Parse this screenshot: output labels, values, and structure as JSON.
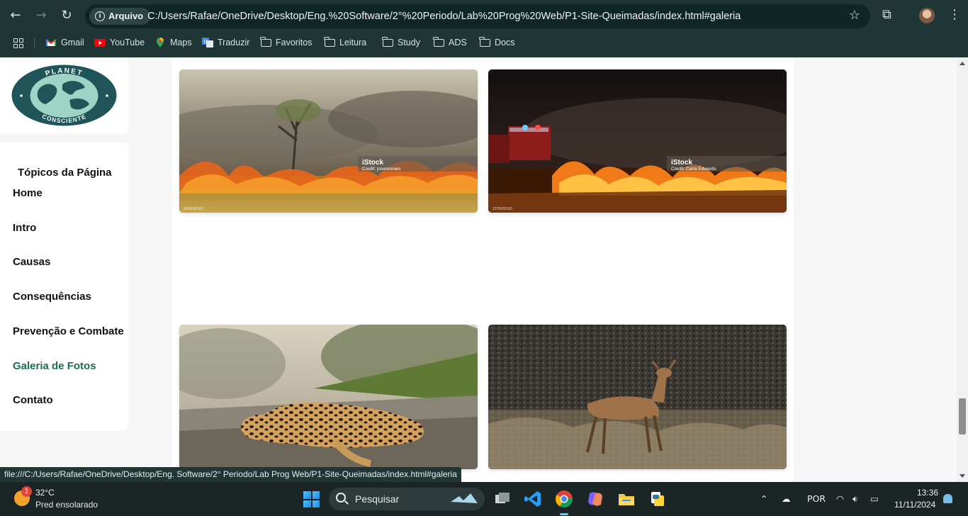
{
  "browser": {
    "chip_label": "Arquivo",
    "url": "C:/Users/Rafae/OneDrive/Desktop/Eng.%20Software/2°%20Periodo/Lab%20Prog%20Web/P1-Site-Queimadas/index.html#galeria",
    "bookmarks": [
      "Gmail",
      "YouTube",
      "Maps",
      "Traduzir",
      "Favoritos",
      "Leitura",
      "Study",
      "ADS",
      "Docs"
    ],
    "status_url": "file:///C:/Users/Rafae/OneDrive/Desktop/Eng. Software/2° Periodo/Lab Prog Web/P1-Site-Queimadas/index.html#galeria"
  },
  "site": {
    "logo_text_top": "PLANET",
    "logo_text_bottom": "CONSCIENTE",
    "nav_title": "Tópicos da Página",
    "nav_items": [
      "Home",
      "Intro",
      "Causas",
      "Consequências",
      "Prevenção e Combate",
      "Galeria de Fotos",
      "Contato"
    ],
    "active_item": "Galeria de Fotos",
    "accent_color": "#1e6b55"
  },
  "gallery": {
    "photos": [
      {
        "watermark": "iStock",
        "credit": "Credit: josemoraes",
        "stock_id": "1435045323",
        "subject": "grassland fire"
      },
      {
        "watermark": "iStock",
        "credit": "Credit: Carla Edwards",
        "stock_id": "1276292163",
        "subject": "fire truck at night fire"
      },
      {
        "subject": "ocelot lying on road"
      },
      {
        "subject": "deer on burned field"
      }
    ]
  },
  "taskbar": {
    "weather_badge": "1",
    "temperature": "32°C",
    "weather_desc": "Pred ensolarado",
    "search_label": "Pesquisar",
    "language": "POR",
    "time": "13:36",
    "date": "11/11/2024"
  }
}
